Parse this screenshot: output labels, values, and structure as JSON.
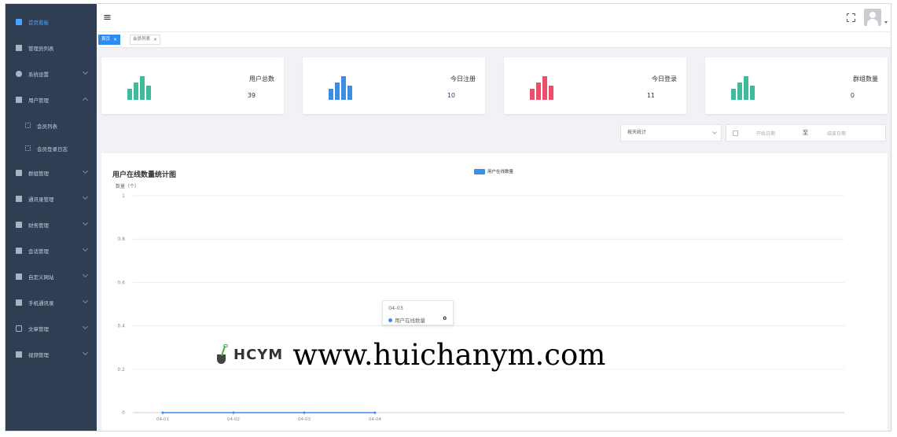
{
  "sidebar": {
    "items": [
      {
        "label": "首页看板",
        "icon": "dashboard-icon",
        "active": true
      },
      {
        "label": "管理员列表",
        "icon": "user-icon"
      },
      {
        "label": "系统设置",
        "icon": "gear-icon"
      },
      {
        "label": "用户管理",
        "icon": "user-icon",
        "expanded": true
      },
      {
        "label": "会员列表",
        "icon": "grid-icon",
        "sub": true
      },
      {
        "label": "会员登录日志",
        "icon": "grid-icon",
        "sub": true
      },
      {
        "label": "群组管理",
        "icon": "group-icon"
      },
      {
        "label": "通讯录管理",
        "icon": "user-icon"
      },
      {
        "label": "财务管理",
        "icon": "finance-icon"
      },
      {
        "label": "会话管理",
        "icon": "chat-icon"
      },
      {
        "label": "自定义网站",
        "icon": "chat-icon"
      },
      {
        "label": "手机通讯录",
        "icon": "contacts-icon"
      },
      {
        "label": "文章管理",
        "icon": "document-icon"
      },
      {
        "label": "视频管理",
        "icon": "video-icon"
      }
    ]
  },
  "header": {
    "menu_icon": "hamburger-icon",
    "fullscreen_icon": "fullscreen-icon",
    "avatar_icon": "avatar-icon"
  },
  "tabs": [
    {
      "label": "首页",
      "active": true
    },
    {
      "label": "会员列表",
      "active": false
    }
  ],
  "stats": [
    {
      "title": "用户总数",
      "value": "39",
      "color": "#3dbb9c"
    },
    {
      "title": "今日注册",
      "value": "10",
      "color": "#3a8ee6"
    },
    {
      "title": "今日登录",
      "value": "11",
      "color": "#ef4b6b"
    },
    {
      "title": "群组数量",
      "value": "0",
      "color": "#3dbb9c"
    }
  ],
  "filter": {
    "mode": "按天统计",
    "start_placeholder": "开始日期",
    "separator": "至",
    "end_placeholder": "结束日期"
  },
  "chart_data": {
    "type": "line",
    "title": "用户在线数量统计图",
    "ylabel": "数量（个）",
    "xlabel": "",
    "legend": "用户在线数量",
    "legend_position": "top-center",
    "series_color": "#3a8ee6",
    "x": [
      "04-01",
      "04-02",
      "04-03",
      "04-04"
    ],
    "series": [
      {
        "name": "用户在线数量",
        "values": [
          0,
          0,
          0,
          0
        ]
      }
    ],
    "ylim": [
      0,
      1
    ],
    "yticks": [
      "0",
      "0.2",
      "0.4",
      "0.6",
      "0.8",
      "1"
    ],
    "grid": true,
    "tooltip": {
      "date": "04-03",
      "series": "用户在线数量",
      "value": "0"
    }
  },
  "watermark": {
    "logo_text": "HCYM",
    "url": "www.huichanym.com"
  }
}
